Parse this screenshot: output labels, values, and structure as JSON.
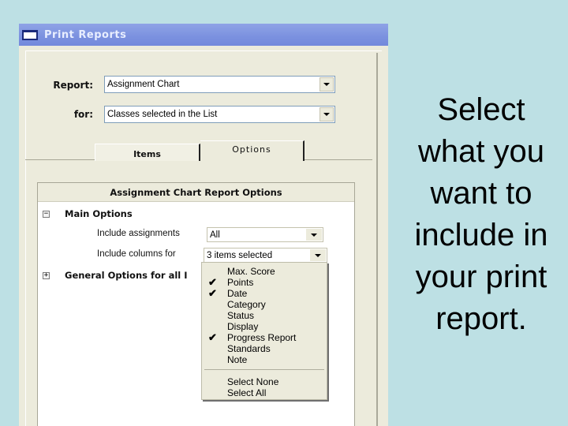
{
  "window": {
    "title": "Print Reports",
    "icon": "window-icon"
  },
  "form": {
    "report_label": "Report:",
    "report_value": "Assignment Chart",
    "for_label": "for:",
    "for_value": "Classes selected in the List"
  },
  "tabs": [
    {
      "label": "Items",
      "active": false
    },
    {
      "label": "Options",
      "active": true
    }
  ],
  "options_panel": {
    "header": "Assignment Chart Report Options",
    "main_group": {
      "label": "Main Options",
      "expanded": true,
      "include_assignments_label": "Include assignments",
      "include_assignments_value": "All",
      "include_columns_label": "Include columns for",
      "include_columns_value": "3 items selected"
    },
    "general_group": {
      "label": "General Options for all I",
      "expanded": false
    }
  },
  "columns_dropdown": {
    "items": [
      {
        "label": "Max. Score",
        "checked": false
      },
      {
        "label": "Points",
        "checked": true
      },
      {
        "label": "Date",
        "checked": true
      },
      {
        "label": "Category",
        "checked": false
      },
      {
        "label": "Status",
        "checked": false
      },
      {
        "label": "Display",
        "checked": false
      },
      {
        "label": "Progress Report",
        "checked": true
      },
      {
        "label": "Standards",
        "checked": false
      },
      {
        "label": "Note",
        "checked": false
      }
    ],
    "select_none": "Select None",
    "select_all": "Select All",
    "check_glyph": "✔"
  },
  "caption": {
    "lines": [
      "Select",
      "what you",
      "want to",
      "include in",
      "your print",
      "report."
    ]
  }
}
